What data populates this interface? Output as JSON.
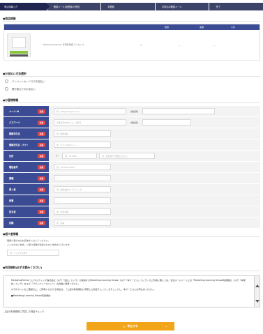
{
  "steps": [
    {
      "label": "申込情報入力"
    },
    {
      "label": "確認メール(仮登録)の受信"
    },
    {
      "label": "本登録"
    },
    {
      "label": "お申込み確認メール"
    },
    {
      "label": "完了"
    }
  ],
  "product": {
    "section_title": "●商品情報",
    "columns": [
      "",
      "",
      "数量",
      "金額",
      "小計"
    ],
    "row": {
      "name": "Marketing Partner 年間利用権 ライセンス",
      "qty": "1",
      "price": "—",
      "subtotal": "—"
    }
  },
  "payment": {
    "section_title": "●お支払い方法選択",
    "options": [
      {
        "label": "クレジットカードでのお支払い"
      },
      {
        "label": "銀行振込でのお支払い"
      }
    ]
  },
  "customer": {
    "section_title": "●お客様情報",
    "required": "必須",
    "fields": {
      "email": {
        "label": "メール id",
        "placeholder": "例：test@example.com",
        "confirm_label": "(確認用)"
      },
      "password": {
        "label": "パスワード",
        "placeholder": "半角英字8文字以上・記号可",
        "confirm_label": "(確認用)"
      },
      "company": {
        "label": "御請求先名",
        "placeholder": "例：株式会社"
      },
      "company_kana": {
        "label": "御請求先名（カナ）",
        "placeholder": "例：カブシキガイシャ"
      },
      "address": {
        "label": "住所",
        "zip_mark": "〒",
        "zip_placeholder": "例：1234567",
        "addr_placeholder": "例：東京都千代田区〇〇〇〇"
      },
      "phone": {
        "label": "電話番号",
        "placeholder": "例：03-XXXX-XXXX"
      },
      "industry": {
        "label": "業種",
        "value": "—"
      },
      "employees": {
        "label": "導入者",
        "placeholder": "例：株式会社マーケティング"
      },
      "dept": {
        "label": "部署",
        "value": "—"
      },
      "name": {
        "label": "担当者",
        "placeholder": "例：担当太郎"
      },
      "title": {
        "label": "役職",
        "placeholder": "例：部長"
      }
    }
  },
  "coupon": {
    "section_title": "●紹介者情報",
    "hint1": "御紹介者の方のお名前を入力してください。",
    "hint2": "ご入力がない場合、ご紹介特典が適用されない場合がございます。",
    "placeholder": "例：ディスクを通す"
  },
  "terms": {
    "section_title": "●利用規約(必ずお読みください)",
    "p1": "MarketingPartnerコンサルティング株式会社（以下「当社」という）が提供するMarketing Learning School（以下「本サービス」という）のご利用に際しては、当社ホームページ上の「Marketing Learning School利用規約」（以下「本規約」という）および「プライバシーポリシー」の内容に同意ください。",
    "p2": "以下のサイトをご確認の上、ご同意いただける場合は、「上記の利用規約に同意した場合チェック」をチェックし、本サービスにお申込みください。",
    "p3": "■Marketing Learning School利用規約"
  },
  "agree_label": "上記の利用規約に同意した場合チェック",
  "submit_label": "申込する",
  "icons": {
    "submit": "mail-icon"
  },
  "colors": {
    "nav": "#3c4368",
    "label_bg": "#3c4c94",
    "required": "#e0474c",
    "submit": "#f3a51a"
  }
}
